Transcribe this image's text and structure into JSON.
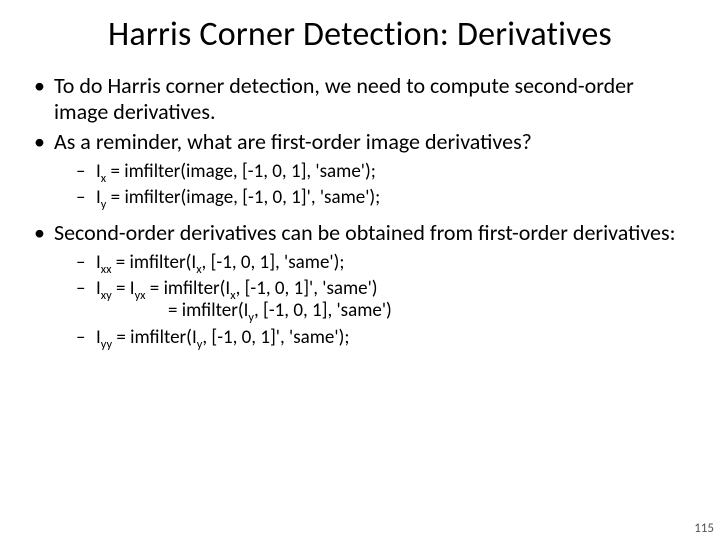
{
  "title": "Harris Corner Detection: Derivatives",
  "bullets": {
    "b1": "To do Harris corner detection, we need to compute second-order image derivatives.",
    "b2": "As a reminder, what are first-order image derivatives?",
    "b3": "Second-order derivatives can be obtained from first-order derivatives:",
    "sub1": {
      "ix_label": "I",
      "ix_sub": "x",
      "ix_expr": " = imfilter(image, [-1, 0, 1], 'same');",
      "iy_label": "I",
      "iy_sub": "y",
      "iy_expr": " = imfilter(image, [-1, 0, 1]', 'same');"
    },
    "sub2": {
      "ixx_label": "I",
      "ixx_sub": "xx",
      "ixx_expr_a": " = imfilter(I",
      "ixx_expr_b": ", [-1, 0, 1], 'same');",
      "ixy_label1": "I",
      "ixy_sub1": "xy",
      "ixy_eq": " = I",
      "ixy_sub2": "yx",
      "ixy_expr_a": " = imfilter(I",
      "ixy_arg_sub_a": "x",
      "ixy_expr_b": ", [-1, 0, 1]', 'same')",
      "ixy_cont_a": "= imfilter(I",
      "ixy_cont_sub": "y",
      "ixy_cont_b": ", [-1, 0, 1], 'same')",
      "iyy_label": "I",
      "iyy_sub": "yy",
      "iyy_expr_a": " = imfilter(I",
      "iyy_arg_sub": "y",
      "iyy_expr_b": ", [-1, 0, 1]', 'same');"
    }
  },
  "pagenum": "115"
}
